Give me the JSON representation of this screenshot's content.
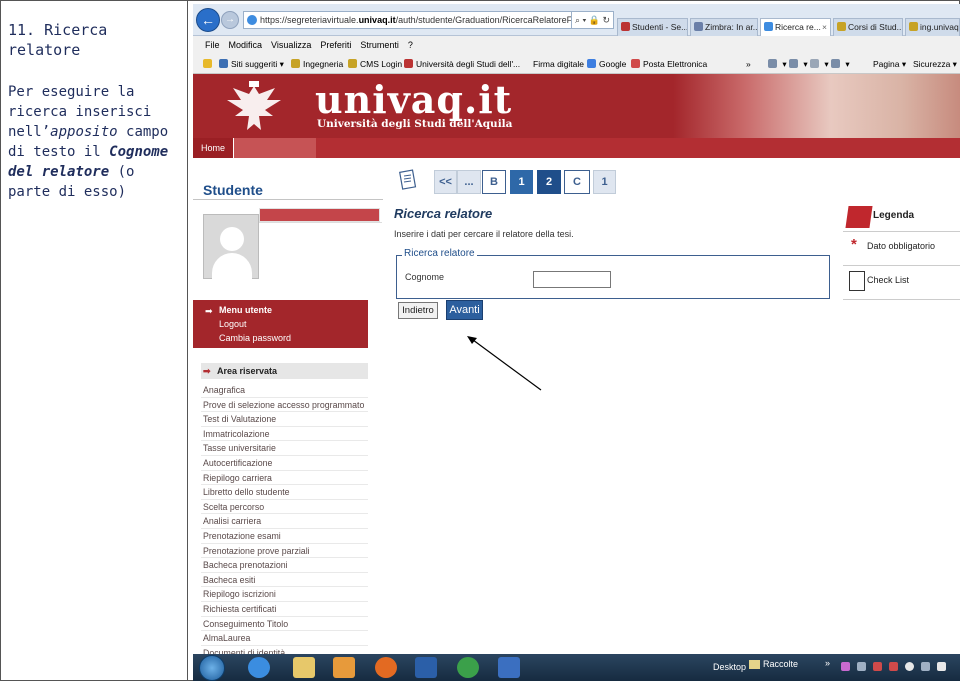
{
  "instruction": {
    "title": "11. Ricerca relatore",
    "text_before": "Per eseguire la ricerca inserisci nell’",
    "text_italic": "apposito",
    "text_mid": " campo di testo il ",
    "text_bold": "Cognome del relatore",
    "text_after": " (o parte di esso)"
  },
  "browser": {
    "back_label": "←",
    "forward_label": "→",
    "url_prefix": "https://segreteriavirtuale.",
    "url_domain": "univaq.it",
    "url_path": "/auth/studente/Graduation/RicercaRelatoreForm.do?ti",
    "url_tools": "⌕ ▾ 🔒 ↻",
    "tabs": [
      "Studenti - Se...",
      "Zimbra: In ar...",
      "Ricerca re...",
      "Corsi di Stud...",
      "ing.univaq"
    ],
    "tab_close": "×",
    "menu": [
      "File",
      "Modifica",
      "Visualizza",
      "Preferiti",
      "Strumenti",
      "?"
    ],
    "favorites": [
      "Siti suggeriti ▾",
      "Ingegneria",
      "CMS Login",
      "Università degli Studi dell'...",
      "Firma digitale",
      "Google",
      "Posta Elettronica"
    ],
    "fav_more": "»",
    "toolbar_right": [
      "Pagina ▾",
      "Sicurezza ▾"
    ]
  },
  "site": {
    "brand": "univaq.it",
    "brand_sub": "Università degli Studi dell'Aquila",
    "home": "Home"
  },
  "sidebar": {
    "title": "Studente",
    "menu_utente": {
      "header": "Menu utente",
      "items": [
        "Logout",
        "Cambia password"
      ]
    },
    "area_riservata": {
      "header": "Area riservata",
      "items": [
        "Anagrafica",
        "Prove di selezione accesso programmato",
        "Test di Valutazione",
        "Immatricolazione",
        "Tasse universitarie",
        "Autocertificazione",
        "Riepilogo carriera",
        "Libretto dello studente",
        "Scelta percorso",
        "Analisi carriera",
        "Prenotazione esami",
        "Prenotazione prove parziali",
        "Bacheca prenotazioni",
        "Bacheca esiti",
        "Riepilogo iscrizioni",
        "Richiesta certificati",
        "Conseguimento Titolo",
        "AlmaLaurea",
        "Documenti di identità"
      ]
    }
  },
  "wizard": {
    "steps": [
      "<<",
      "...",
      "B",
      "1",
      "2",
      "C",
      "1"
    ]
  },
  "form": {
    "title": "Ricerca relatore",
    "subtitle": "Inserire i dati per cercare il relatore della tesi.",
    "fieldset_legend": "Ricerca relatore",
    "cognome_label": "Cognome",
    "cognome_value": "",
    "back_button": "Indietro",
    "next_button": "Avanti"
  },
  "legend": {
    "title": "Legenda",
    "required": "Dato obbligatorio",
    "required_mark": "*",
    "checklist": "Check List"
  },
  "taskbar": {
    "desktop": "Desktop",
    "raccolte": "Raccolte",
    "more": "»"
  }
}
